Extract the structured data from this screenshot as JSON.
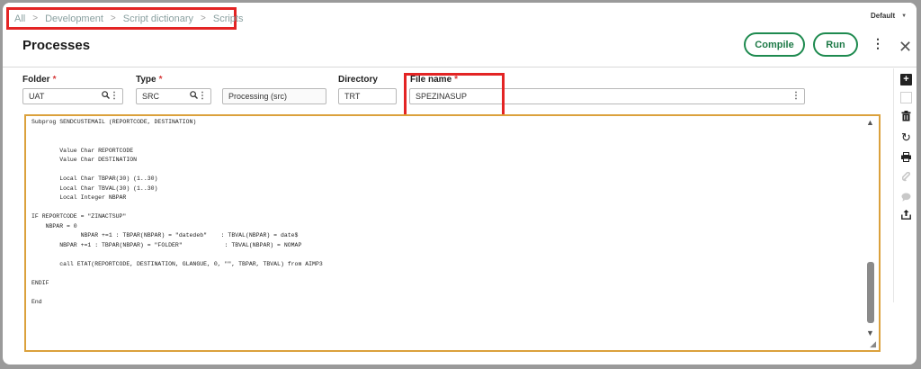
{
  "breadcrumb": [
    "All",
    "Development",
    "Script dictionary",
    "Scripts"
  ],
  "page": {
    "title": "Processes",
    "profile_selector": "Default"
  },
  "actions": {
    "compile": "Compile",
    "run": "Run"
  },
  "fields": {
    "folder": {
      "label": "Folder",
      "value": "UAT"
    },
    "type": {
      "label": "Type",
      "value": "SRC"
    },
    "type_description": {
      "value": "Processing (src)"
    },
    "directory": {
      "label": "Directory",
      "value": "TRT"
    },
    "file_name": {
      "label": "File name",
      "value": "SPEZINASUP"
    }
  },
  "required_marker": "*",
  "editor": {
    "code": "Subprog SENDCUSTEMAIL (REPORTCODE, DESTINATION)\n\n\n        Value Char REPORTCODE\n        Value Char DESTINATION\n\n        Local Char TBPAR(30) (1..30)\n        Local Char TBVAL(30) (1..30)\n        Local Integer NBPAR\n\nIF REPORTCODE = \"ZINACTSUP\"\n    NBPAR = 0\n              NBPAR +=1 : TBPAR(NBPAR) = \"datedeb\"    : TBVAL(NBPAR) = date$\n        NBPAR +=1 : TBPAR(NBPAR) = \"FOLDER\"            : TBVAL(NBPAR) = NOMAP\n\n        call ETAT(REPORTCODE, DESTINATION, GLANGUE, 0, \"\", TBPAR, TBVAL) from AIMP3\n\nENDIF\n\nEnd"
  },
  "toolbar": {
    "icons": [
      "plus-icon",
      "new-record-icon",
      "delete-icon",
      "refresh-icon",
      "print-icon",
      "attachment-icon",
      "comment-icon",
      "export-icon"
    ]
  }
}
